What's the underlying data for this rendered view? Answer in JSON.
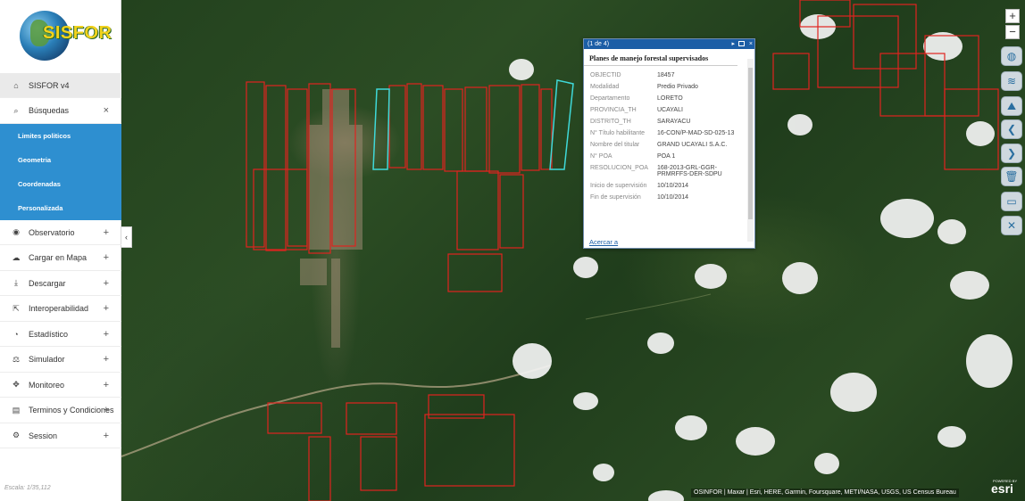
{
  "app": {
    "logo_text": "SISFOR"
  },
  "sidebar": {
    "items": [
      {
        "label": "SISFOR v4",
        "icon": "home-icon",
        "glyph": "⌂",
        "action": ""
      },
      {
        "label": "Búsquedas",
        "icon": "search-icon",
        "glyph": "⌕",
        "action": "×"
      },
      {
        "label": "Observatorio",
        "icon": "eye-icon",
        "glyph": "◉",
        "action": "+"
      },
      {
        "label": "Cargar en Mapa",
        "icon": "cloud-upload-icon",
        "glyph": "☁",
        "action": "+"
      },
      {
        "label": "Descargar",
        "icon": "download-icon",
        "glyph": "⤓",
        "action": "+"
      },
      {
        "label": "Interoperabilidad",
        "icon": "external-link-icon",
        "glyph": "⇱",
        "action": "+"
      },
      {
        "label": "Estadístico",
        "icon": "pie-chart-icon",
        "glyph": "◔",
        "action": "+"
      },
      {
        "label": "Simulador",
        "icon": "balance-scale-icon",
        "glyph": "⚖",
        "action": "+"
      },
      {
        "label": "Monitoreo",
        "icon": "crosshair-icon",
        "glyph": "✥",
        "action": "+"
      },
      {
        "label": "Terminos y Condiciones",
        "icon": "newspaper-icon",
        "glyph": "▤",
        "action": "+"
      },
      {
        "label": "Session",
        "icon": "settings-icon",
        "glyph": "⚙",
        "action": "+"
      }
    ],
    "search_subitems": [
      "Limites politicos",
      "Geometria",
      "Coordenadas",
      "Personalizada"
    ],
    "scale_text": "Escala: 1/35,112"
  },
  "map": {
    "zoom_in": "+",
    "zoom_out": "−",
    "tools": [
      {
        "icon": "globe-icon",
        "glyph": "◍"
      },
      {
        "icon": "layers-icon",
        "glyph": "≋"
      },
      {
        "icon": "mountain-icon",
        "glyph": "⛰"
      },
      {
        "icon": "back-arrow-icon",
        "glyph": "❮"
      },
      {
        "icon": "forward-arrow-icon",
        "glyph": "❯"
      },
      {
        "icon": "trash-icon",
        "glyph": "🗑"
      },
      {
        "icon": "print-icon",
        "glyph": "▭"
      },
      {
        "icon": "tools-icon",
        "glyph": "✕"
      }
    ],
    "attribution": "OSINFOR | Maxar | Esri, HERE, Garmin, Foursquare, METI/NASA, USGS, US Census Bureau",
    "esri_label": "esri",
    "esri_powered": "POWERED BY"
  },
  "popup": {
    "counter": "(1 de 4)",
    "next_glyph": "▸",
    "close_glyph": "×",
    "title": "Planes de manejo forestal supervisados",
    "fields": [
      {
        "key": "OBJECTID",
        "value": "18457"
      },
      {
        "key": "Modalidad",
        "value": "Predio Privado"
      },
      {
        "key": "Departamento",
        "value": "LORETO"
      },
      {
        "key": "PROVINCIA_TH",
        "value": "UCAYALI"
      },
      {
        "key": "DISTRITO_TH",
        "value": "SARAYACU"
      },
      {
        "key": "N° Título habilitante",
        "value": "16-CON/P-MAD-SD-025-13"
      },
      {
        "key": "Nombre del titular",
        "value": "GRAND UCAYALI S.A.C."
      },
      {
        "key": "N° POA",
        "value": "POA 1"
      },
      {
        "key": "RESOLUCION_POA",
        "value": "168-2013-GRL-GGR-PRMRFFS-DER-SDPU"
      },
      {
        "key": "Inicio de supervisión",
        "value": "10/10/2014"
      },
      {
        "key": "Fin de supervisión",
        "value": "10/10/2014"
      }
    ],
    "link": "Acercar a"
  },
  "colors": {
    "sidebar_sub": "#2e8fd0",
    "popup_header": "#1c5ea6",
    "parcel_red": "#e0231f",
    "parcel_cyan": "#3fd9d9"
  }
}
